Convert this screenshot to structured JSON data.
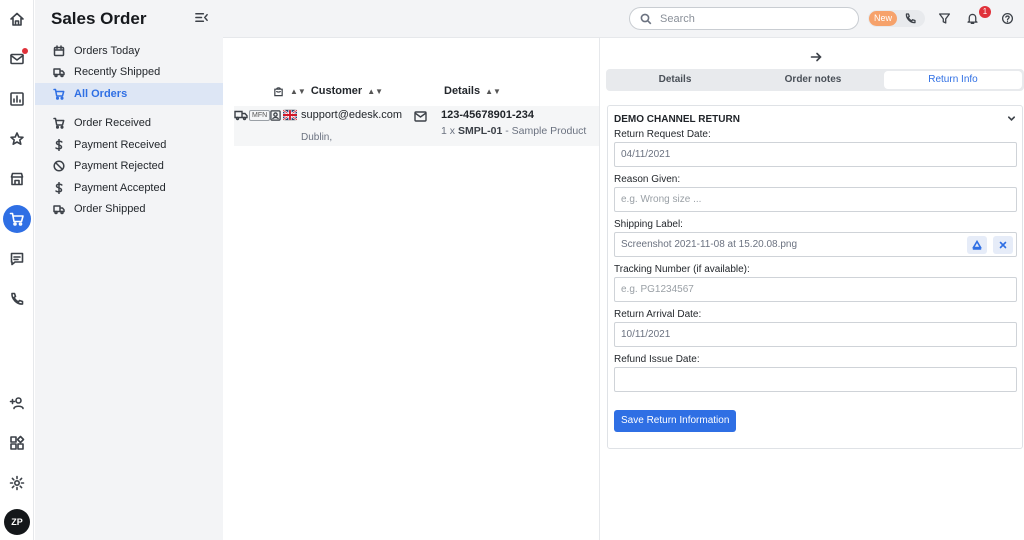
{
  "sidebar": {
    "title": "Sales Order",
    "items": [
      {
        "label": "Orders Today",
        "icon": "calendar-icon"
      },
      {
        "label": "Recently Shipped",
        "icon": "truck-icon"
      },
      {
        "label": "All Orders",
        "icon": "cart-icon",
        "active": true
      },
      {
        "label": "Order Received",
        "icon": "cart-icon"
      },
      {
        "label": "Payment Received",
        "icon": "dollar-icon"
      },
      {
        "label": "Payment Rejected",
        "icon": "blocked-icon"
      },
      {
        "label": "Payment Accepted",
        "icon": "dollar-icon"
      },
      {
        "label": "Order Shipped",
        "icon": "truck-icon"
      }
    ]
  },
  "rail": {
    "icons": [
      "home-icon",
      "mail-icon",
      "chart-icon",
      "star-icon",
      "store-icon",
      "cart-icon",
      "chat-icon",
      "phone-icon",
      "add-user-icon",
      "apps-icon",
      "settings-icon"
    ],
    "avatar_initials": "ZP"
  },
  "topbar": {
    "search_placeholder": "Search",
    "new_badge": "New",
    "notification_count": "1"
  },
  "orders": {
    "columns": {
      "customer": "Customer",
      "details": "Details"
    },
    "rows": [
      {
        "badge": "MFN",
        "email": "support@edesk.com",
        "city": "Dublin,",
        "order_number": "123-45678901-234",
        "qty": "1 x",
        "sku": "SMPL-01",
        "product": "- Sample Product"
      }
    ]
  },
  "panel": {
    "tabs": [
      "Details",
      "Order notes",
      "Return Info"
    ],
    "active_tab": "Return Info",
    "section_title": "DEMO CHANNEL RETURN",
    "fields": {
      "return_request_date": {
        "label": "Return Request Date:",
        "value": "04/11/2021"
      },
      "reason_given": {
        "label": "Reason Given:",
        "placeholder": "e.g. Wrong size ..."
      },
      "shipping_label": {
        "label": "Shipping Label:",
        "value": "Screenshot 2021-11-08 at 15.20.08.png"
      },
      "tracking_number": {
        "label": "Tracking Number (if available):",
        "placeholder": "e.g. PG1234567"
      },
      "return_arrival_date": {
        "label": "Return Arrival Date:",
        "value": "10/11/2021"
      },
      "refund_issue_date": {
        "label": "Refund Issue Date:",
        "value": ""
      }
    },
    "save_label": "Save Return Information"
  },
  "colors": {
    "accent": "#2f6fe4",
    "badge_orange": "#f6a26b",
    "alert_red": "#e0313a"
  }
}
